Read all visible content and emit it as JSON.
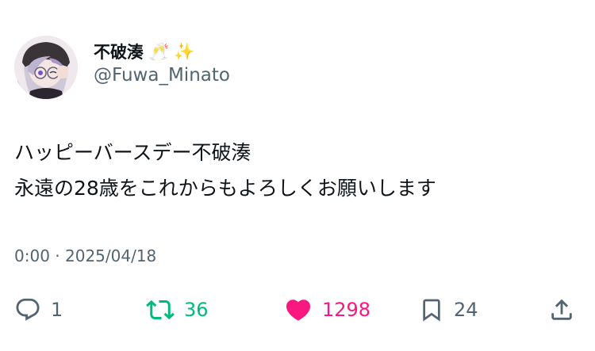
{
  "author": {
    "display_name": "不破湊",
    "emoji_1": "🥂",
    "emoji_2": "✨",
    "handle": "@Fuwa_Minato"
  },
  "tweet": {
    "line_1": "ハッピーバースデー不破湊",
    "line_2": "永遠の28歳をこれからもよろしくお願いします"
  },
  "meta": {
    "time": "0:00",
    "separator": "·",
    "date": "2025/04/18"
  },
  "actions": {
    "replies": "1",
    "reposts": "36",
    "likes": "1298",
    "bookmarks": "24"
  },
  "colors": {
    "repost_active": "#00ba7c",
    "like_active": "#f91880",
    "secondary_text": "#536471",
    "primary_text": "#0f1419"
  },
  "icons": {
    "reply": "reply-icon",
    "repost": "repost-icon",
    "like": "heart-icon",
    "bookmark": "bookmark-icon",
    "share": "share-icon"
  }
}
